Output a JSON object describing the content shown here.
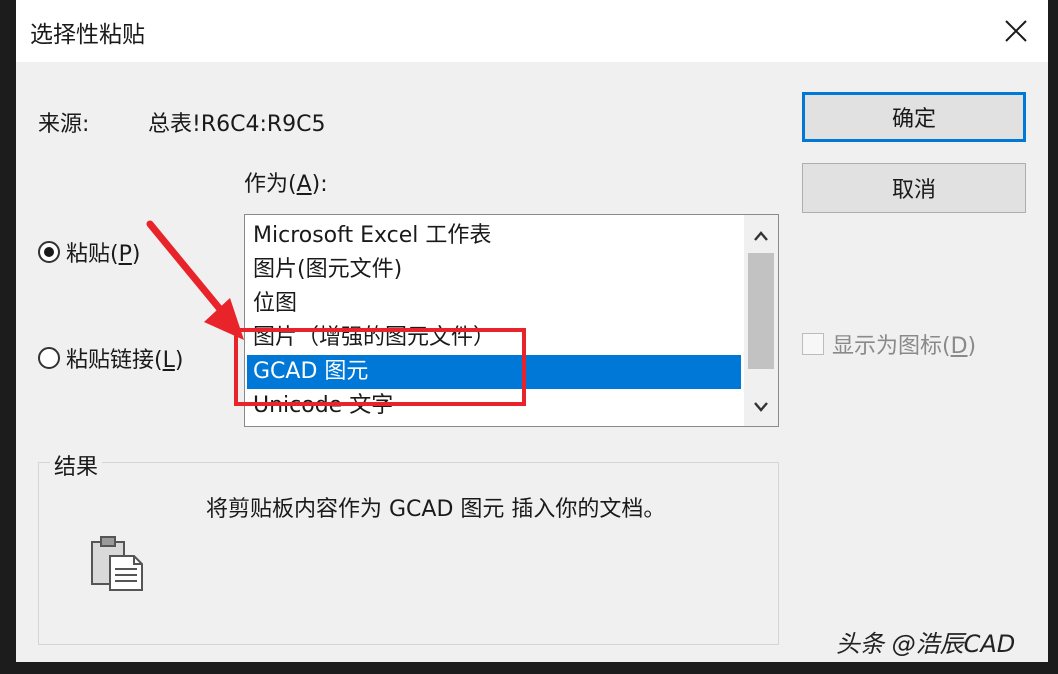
{
  "dialog": {
    "title": "选择性粘贴",
    "close_glyph": "✕"
  },
  "source": {
    "label": "来源:",
    "value": "总表!R6C4:R9C5"
  },
  "as_label": "作为(A):",
  "options": {
    "paste_label": "粘贴(P)",
    "paste_link_label": "粘贴链接(L)",
    "selected": "paste"
  },
  "list": {
    "items": [
      "Microsoft Excel 工作表",
      "图片(图元文件)",
      "位图",
      "图片（增强的图元文件）",
      "GCAD 图元",
      "Unicode 文字"
    ],
    "selected_index": 4
  },
  "buttons": {
    "ok": "确定",
    "cancel": "取消"
  },
  "display_as_icon": {
    "label": "显示为图标(D)",
    "checked": false
  },
  "result": {
    "legend": "结果",
    "text": "将剪贴板内容作为 GCAD 图元 插入你的文档。"
  },
  "annotation": {
    "highlight_color": "#e8232a"
  },
  "watermark": "头条 @浩辰CAD",
  "colors": {
    "accent": "#0078d7",
    "annotation": "#e8232a"
  }
}
